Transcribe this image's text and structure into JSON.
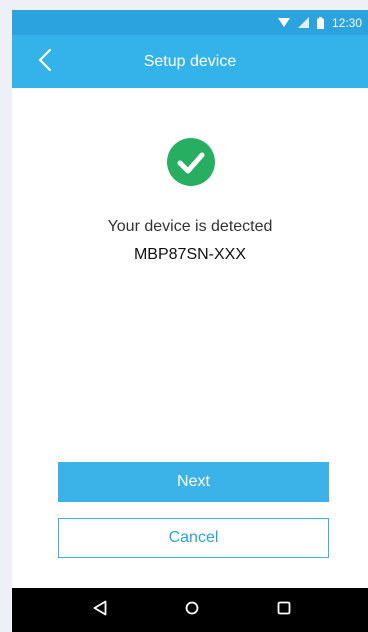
{
  "status_bar": {
    "time": "12:30",
    "icons": [
      "wifi-icon",
      "signal-icon",
      "battery-icon"
    ]
  },
  "app_bar": {
    "title": "Setup device",
    "back_icon": "chevron-left-icon"
  },
  "content": {
    "status_icon": "check-circle-icon",
    "message": "Your device is detected",
    "device_name": "MBP87SN-XXX"
  },
  "actions": {
    "next_label": "Next",
    "cancel_label": "Cancel"
  },
  "nav_bar": {
    "icons": [
      "back-triangle-icon",
      "home-circle-icon",
      "recents-square-icon"
    ]
  },
  "colors": {
    "status_bar": "#2aa3de",
    "app_bar": "#33b3ea",
    "primary_button": "#3cb3e8",
    "success": "#27ae60",
    "nav_bar": "#000000"
  }
}
